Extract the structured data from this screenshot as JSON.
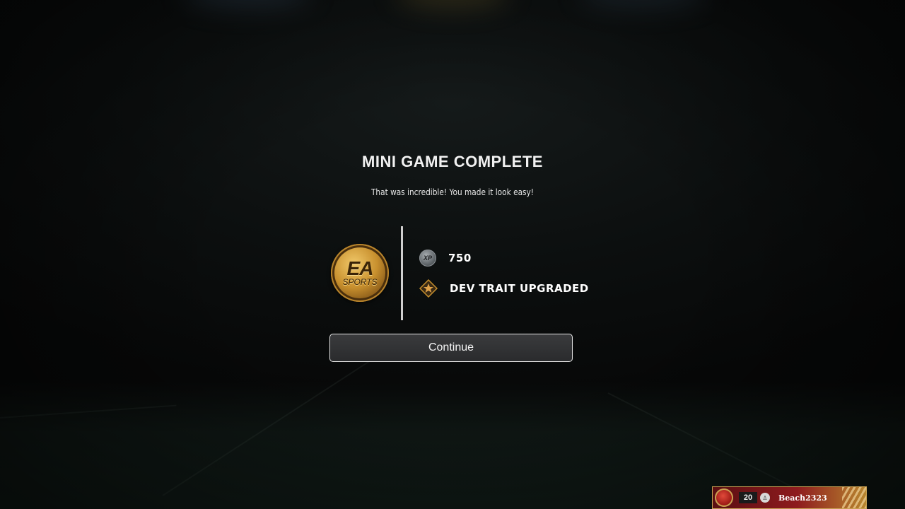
{
  "modal": {
    "title": "MINI GAME COMPLETE",
    "subtitle": "That was incredible! You made it look easy!"
  },
  "coin": {
    "line1": "EA",
    "line2": "SPORTS"
  },
  "rewards": [
    {
      "icon": "xp-coin-icon",
      "icon_text": "XP",
      "label": "750"
    },
    {
      "icon": "dev-trait-icon",
      "label": "DEV TRAIT UPGRADED"
    }
  ],
  "continue_label": "Continue",
  "player_card": {
    "level": "20",
    "gamertag": "Beach2323",
    "team_colors": {
      "primary": "#8e1b1e",
      "secondary": "#c9a253"
    }
  },
  "colors": {
    "background": "#0b0d0d",
    "gold": "#c8902e",
    "button_border": "#e8e8e8"
  }
}
